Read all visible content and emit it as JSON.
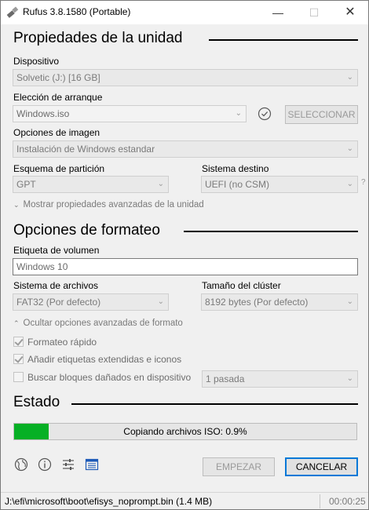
{
  "window": {
    "title": "Rufus 3.8.1580 (Portable)",
    "minimize_glyph": "—",
    "maximize_glyph": "☐",
    "close_glyph": "✕"
  },
  "drive_properties": {
    "section_title": "Propiedades de la unidad",
    "device_label": "Dispositivo",
    "device_value": "Solvetic (J:) [16 GB]",
    "boot_selection_label": "Elección de arranque",
    "boot_selection_value": "Windows.iso",
    "select_button": "SELECCIONAR",
    "image_option_label": "Opciones de imagen",
    "image_option_value": "Instalación de Windows estandar",
    "partition_scheme_label": "Esquema de partición",
    "partition_scheme_value": "GPT",
    "target_system_label": "Sistema destino",
    "target_system_value": "UEFI (no CSM)",
    "help_mark": "?",
    "advanced_toggle": "Mostrar propiedades avanzadas de la unidad"
  },
  "format_options": {
    "section_title": "Opciones de formateo",
    "volume_label_label": "Etiqueta de volumen",
    "volume_label_value": "Windows 10",
    "file_system_label": "Sistema de archivos",
    "file_system_value": "FAT32 (Por defecto)",
    "cluster_size_label": "Tamaño del clúster",
    "cluster_size_value": "8192 bytes (Por defecto)",
    "advanced_toggle": "Ocultar opciones avanzadas de formato",
    "quick_format": "Formateo rápido",
    "quick_format_checked": true,
    "extended_labels": "Añadir etiquetas extendidas e iconos",
    "extended_labels_checked": true,
    "bad_blocks": "Buscar bloques dañados en dispositivo",
    "bad_blocks_checked": false,
    "passes_value": "1 pasada"
  },
  "status": {
    "section_title": "Estado",
    "progress_text": "Copiando archivos ISO: 0.9%",
    "progress_fraction": 0.1,
    "progress_color": "#06b025",
    "start_button": "EMPEZAR",
    "cancel_button": "CANCELAR"
  },
  "toolbar_icons": [
    "globe-icon",
    "info-icon",
    "settings-sliders-icon",
    "log-icon"
  ],
  "statusbar": {
    "path_text": "J:\\efi\\microsoft\\boot\\efisys_noprompt.bin (1.4 MB)",
    "elapsed": "00:00:25"
  }
}
